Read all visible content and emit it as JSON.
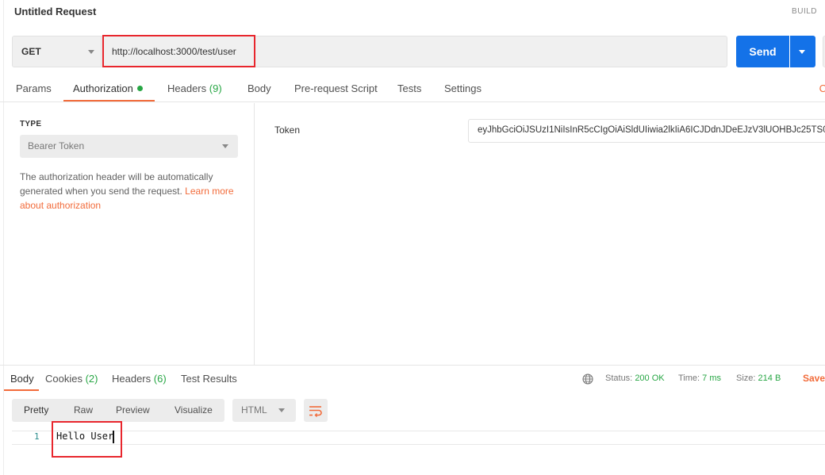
{
  "header": {
    "title": "Untitled Request",
    "build": "BUILD"
  },
  "request": {
    "method": "GET",
    "url": "http://localhost:3000/test/user",
    "send_label": "Send"
  },
  "tabs": [
    {
      "label": "Params"
    },
    {
      "label": "Authorization"
    },
    {
      "label": "Headers",
      "count": "(9)"
    },
    {
      "label": "Body"
    },
    {
      "label": "Pre-request Script"
    },
    {
      "label": "Tests"
    },
    {
      "label": "Settings"
    },
    {
      "label": "C"
    }
  ],
  "auth": {
    "type_label": "TYPE",
    "type_value": "Bearer Token",
    "description": "The authorization header will be automatically generated when you send the request.",
    "learn_more": "Learn more about authorization",
    "token_label": "Token",
    "token_value": "eyJhbGciOiJSUzI1NiIsInR5cCIgOiAiSldUIiwia2lkIiA6ICJDdnJDeEJzV3lUOHBJc25TS0"
  },
  "response": {
    "tabs": [
      {
        "label": "Body"
      },
      {
        "label": "Cookies",
        "count": "(2)"
      },
      {
        "label": "Headers",
        "count": "(6)"
      },
      {
        "label": "Test Results"
      }
    ],
    "status_label": "Status:",
    "status_value": "200 OK",
    "time_label": "Time:",
    "time_value": "7 ms",
    "size_label": "Size:",
    "size_value": "214 B",
    "save_label": "Save",
    "views": [
      "Pretty",
      "Raw",
      "Preview",
      "Visualize"
    ],
    "format": "HTML",
    "line_number": "1",
    "body": "Hello User"
  },
  "icons": {
    "globe": "globe-icon",
    "wrap": "wrap-lines-icon"
  },
  "colors": {
    "accent": "#f26b3a",
    "send": "#1472e8",
    "success": "#27a644",
    "highlight": "#e8262d"
  }
}
